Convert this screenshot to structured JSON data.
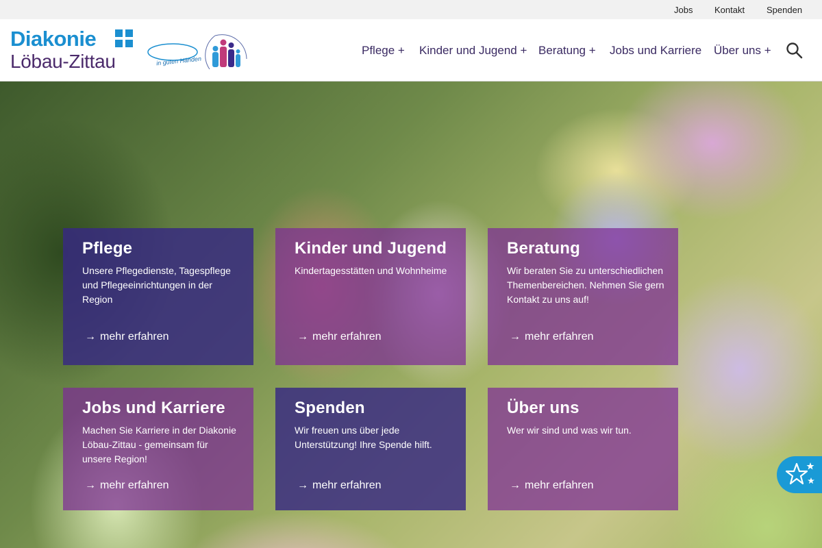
{
  "topbar": {
    "links": [
      "Jobs",
      "Kontakt",
      "Spenden"
    ]
  },
  "brand": {
    "name": "Diakonie",
    "region": "Löbau-Zittau",
    "seal_text": "in guten Händen",
    "cross_icon": "diakonie-cross-icon"
  },
  "nav": {
    "items": [
      "Pflege +",
      "Kinder und Jugend +",
      "Beratung +",
      "Jobs und Karriere",
      "Über uns +"
    ],
    "search_icon": "magnifier-icon"
  },
  "cards": [
    {
      "title": "Pflege",
      "text": "Unsere Pflegedienste, Tagespflege und Pflegeeinrichtungen in der Region",
      "link": "mehr erfahren"
    },
    {
      "title": "Kinder und Jugend",
      "text": "Kindertagesstätten und Wohnheime",
      "link": "mehr erfahren"
    },
    {
      "title": "Beratung",
      "text": "Wir beraten Sie zu unterschiedlichen Themenbereichen. Nehmen Sie gern Kontakt zu uns auf!",
      "link": "mehr erfahren"
    },
    {
      "title": "Jobs und Karriere",
      "text": "Machen Sie Karriere in der Diakonie Löbau-Zittau - gemeinsam für unsere Region!",
      "link": "mehr erfahren"
    },
    {
      "title": "Spenden",
      "text": "Wir freuen uns über jede Unterstützung! Ihre Spende hilft.",
      "link": "mehr erfahren"
    },
    {
      "title": "Über uns",
      "text": "Wer wir sind und was wir tun.",
      "link": "mehr erfahren"
    }
  ],
  "colors": {
    "accent_blue": "#1b8fd0",
    "brand_purple": "#4b2a6b",
    "card_blue": "#372882",
    "card_purple": "#7d2d96"
  },
  "floating_button": {
    "icon": "stars-icon"
  }
}
